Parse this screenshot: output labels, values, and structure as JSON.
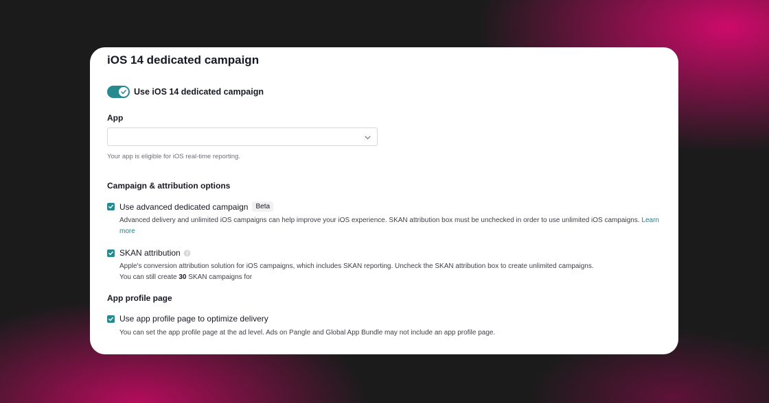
{
  "card": {
    "title": "iOS 14 dedicated campaign",
    "toggle": {
      "label": "Use iOS 14 dedicated campaign",
      "on": true
    },
    "app": {
      "label": "App",
      "select_value": "",
      "helper": "Your app is eligible for iOS real-time reporting."
    },
    "campaign_section": {
      "title": "Campaign & attribution options",
      "advanced": {
        "label": "Use advanced dedicated campaign",
        "checked": true,
        "badge": "Beta",
        "description": "Advanced delivery and unlimited iOS campaigns can help improve your iOS experience. SKAN attribution box must be unchecked in order to use unlimited iOS campaigns.",
        "link": "Learn more"
      },
      "skan": {
        "label": "SKAN attribution",
        "checked": true,
        "description": "Apple's conversion attribution solution for iOS campaigns, which includes SKAN reporting. Uncheck the SKAN attribution box to create unlimited campaigns.",
        "count_prefix": "You can still create",
        "count": "30",
        "count_suffix": "SKAN campaigns for"
      }
    },
    "profile_section": {
      "title": "App profile page",
      "option": {
        "label": "Use app profile page to optimize delivery",
        "checked": true,
        "description": "You can set the app profile page at the ad level. Ads on Pangle and Global App Bundle may not include an app profile page."
      }
    }
  },
  "colors": {
    "accent": "#278a8f",
    "link": "#1f7f86",
    "text": "#161823",
    "muted": "#6d6f76"
  },
  "icons": {
    "toggle": "check-icon",
    "select": "chevron-down-icon",
    "help": "question-icon"
  }
}
